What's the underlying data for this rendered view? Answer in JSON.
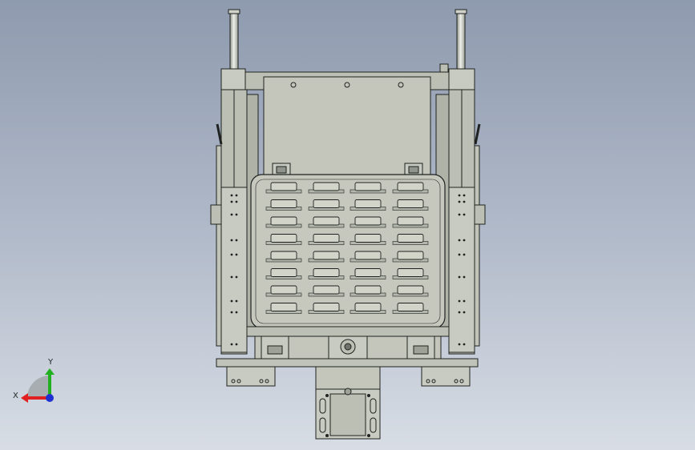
{
  "viewport": {
    "colors": {
      "bg_top": "#8e9aae",
      "bg_bottom": "#d8dde5",
      "steel": "#bcc0b4",
      "steel_light": "#cfd2c8",
      "steel_dark": "#9da196",
      "outline": "#1f2220"
    }
  },
  "triad": {
    "x_label": "X",
    "y_label": "Y",
    "x_color": "#e02020",
    "y_color": "#20b020",
    "z_color": "#2030d0"
  },
  "model": {
    "tray_rows": 8,
    "tray_columns": 4
  }
}
